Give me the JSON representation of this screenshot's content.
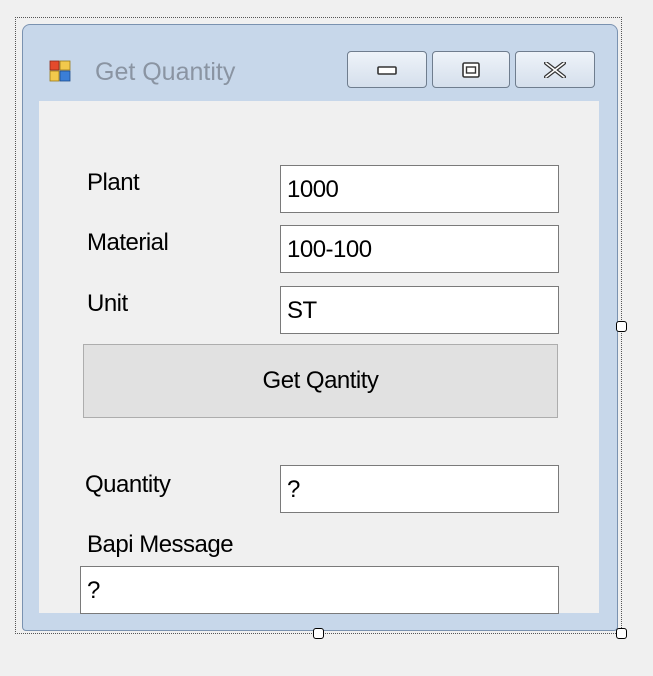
{
  "window": {
    "title": "Get Quantity",
    "icon": "winforms-app-icon",
    "controls": {
      "minimize_icon": "minimize-icon",
      "maximize_icon": "maximize-icon",
      "close_icon": "close-icon"
    }
  },
  "form": {
    "plant": {
      "label": "Plant",
      "value": "1000"
    },
    "material": {
      "label": "Material",
      "value": "100-100"
    },
    "unit": {
      "label": "Unit",
      "value": "ST"
    },
    "get_button_label": "Get Qantity",
    "quantity": {
      "label": "Quantity",
      "value": "?"
    },
    "bapi_message": {
      "label": "Bapi Message",
      "value": "?"
    }
  },
  "colors": {
    "window_frame": "#c7d7ea",
    "client_background": "#f0f0f0",
    "title_text": "#8a94a2",
    "button_face": "#e1e1e1"
  }
}
